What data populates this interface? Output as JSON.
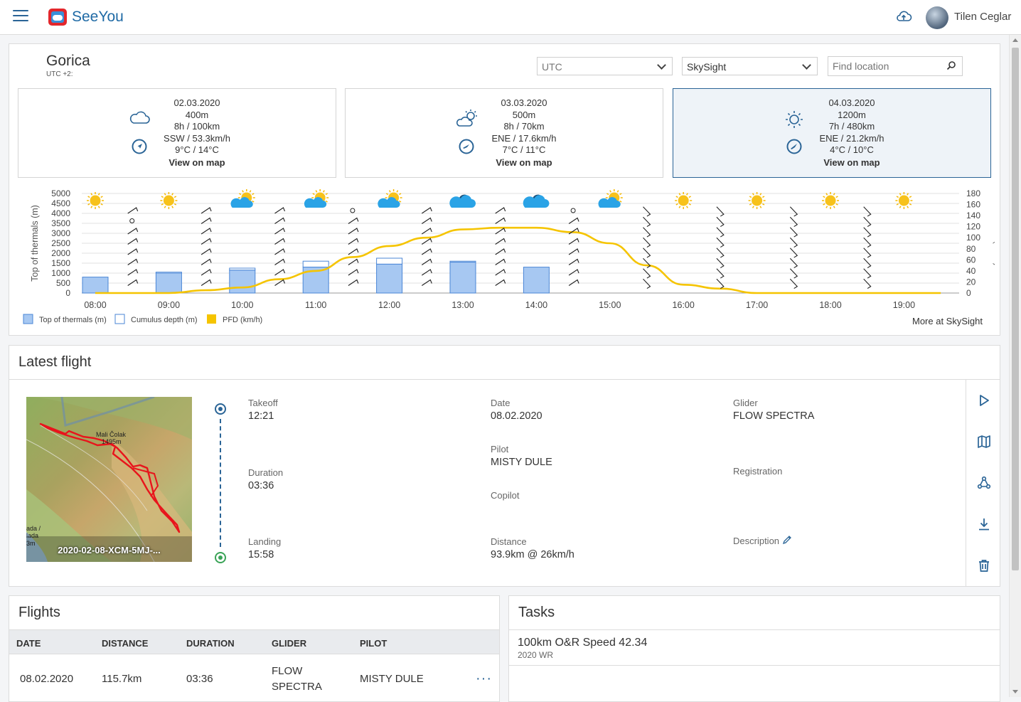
{
  "app": {
    "brand": "SeeYou",
    "user_name": "Tilen Ceglar"
  },
  "location": {
    "name": "Gorica",
    "timezone": "UTC +2:",
    "time_select": "UTC",
    "source_select": "SkySight",
    "find_placeholder": "Find location"
  },
  "days": [
    {
      "date": "02.03.2020",
      "height": "400m",
      "hours": "8h / 100km",
      "wind": "SSW / 53.3km/h",
      "temp": "9°C / 14°C",
      "link": "View on map",
      "icon": "cloud-icon",
      "wind_dir_deg": 202
    },
    {
      "date": "03.03.2020",
      "height": "500m",
      "hours": "8h / 70km",
      "wind": "ENE / 17.6km/h",
      "temp": "7°C / 11°C",
      "link": "View on map",
      "icon": "partly-sunny-icon",
      "wind_dir_deg": 67
    },
    {
      "date": "04.03.2020",
      "height": "1200m",
      "hours": "7h / 480km",
      "wind": "ENE / 21.2km/h",
      "temp": "4°C / 10°C",
      "link": "View on map",
      "icon": "sun-icon",
      "wind_dir_deg": 67
    }
  ],
  "chart_data": {
    "type": "bar",
    "categories": [
      "08:00",
      "09:00",
      "10:00",
      "11:00",
      "12:00",
      "13:00",
      "14:00",
      "15:00",
      "16:00",
      "17:00",
      "18:00",
      "19:00"
    ],
    "series": [
      {
        "name": "Top of thermals (m)",
        "type": "bar",
        "values": [
          800,
          1000,
          1150,
          1300,
          1450,
          1550,
          1300,
          0,
          0,
          0,
          0,
          0
        ]
      },
      {
        "name": "Cumulus depth (m)",
        "type": "bar-outline",
        "values": [
          0,
          50,
          100,
          300,
          300,
          50,
          0,
          0,
          0,
          0,
          0,
          0
        ]
      },
      {
        "name": "PFD (km/h)",
        "type": "line",
        "axis": "right",
        "x": [
          8,
          9,
          9.5,
          10,
          10.5,
          11,
          11.5,
          12,
          12.5,
          13,
          13.5,
          14,
          14.5,
          15,
          15.5,
          16,
          16.5,
          17,
          17.5,
          18,
          18.5,
          19,
          19.5
        ],
        "values": [
          0,
          0,
          5,
          10,
          25,
          40,
          65,
          85,
          100,
          115,
          118,
          118,
          110,
          90,
          50,
          15,
          8,
          0,
          0,
          0,
          0,
          0,
          0
        ]
      }
    ],
    "y_left_label": "Top of thermals (m)",
    "y_left_ticks": [
      0,
      500,
      1000,
      1500,
      2000,
      2500,
      3000,
      3500,
      4000,
      4500,
      5000
    ],
    "y_left_range": [
      0,
      5000
    ],
    "y_right_label": "PFD (km/h)",
    "y_right_ticks": [
      0,
      20,
      40,
      60,
      80,
      100,
      120,
      140,
      160,
      180
    ],
    "y_right_range": [
      0,
      180
    ],
    "sky_icons": [
      "sun",
      "sun",
      "partly-cloudy",
      "partly-cloudy",
      "partly-cloudy",
      "cloud",
      "cloud",
      "partly-cloudy",
      "sun",
      "sun",
      "sun",
      "sun"
    ],
    "grid": true,
    "legend_position": "bottom-left",
    "accent_bar": "#a7c8f2",
    "accent_line": "#f5c400"
  },
  "more_link": "More at SkySight",
  "latest_flight": {
    "title": "Latest flight",
    "map_caption": "2020-02-08-XCM-5MJ-...",
    "map_labels": {
      "peak": "Mali Čolak",
      "peak_alt": "1495m",
      "edge1": "ada /",
      "edge2": "lada",
      "edge3": "3m"
    },
    "takeoff_label": "Takeoff",
    "takeoff": "12:21",
    "duration_label": "Duration",
    "duration": "03:36",
    "landing_label": "Landing",
    "landing": "15:58",
    "date_label": "Date",
    "date": "08.02.2020",
    "pilot_label": "Pilot",
    "pilot": "MISTY DULE",
    "copilot_label": "Copilot",
    "distance_label": "Distance",
    "distance": "93.9km @ 26km/h",
    "glider_label": "Glider",
    "glider": "FLOW SPECTRA",
    "registration_label": "Registration",
    "description_label": "Description"
  },
  "flights": {
    "title": "Flights",
    "columns": [
      "DATE",
      "DISTANCE",
      "DURATION",
      "GLIDER",
      "PILOT"
    ],
    "rows": [
      {
        "date": "08.02.2020",
        "distance": "115.7km",
        "duration": "03:36",
        "glider_line1": "FLOW",
        "glider_line2": "SPECTRA",
        "pilot": "MISTY DULE"
      }
    ]
  },
  "tasks": {
    "title": "Tasks",
    "items": [
      {
        "name": "100km O&R Speed 42.34",
        "sub": "2020 WR"
      }
    ]
  }
}
